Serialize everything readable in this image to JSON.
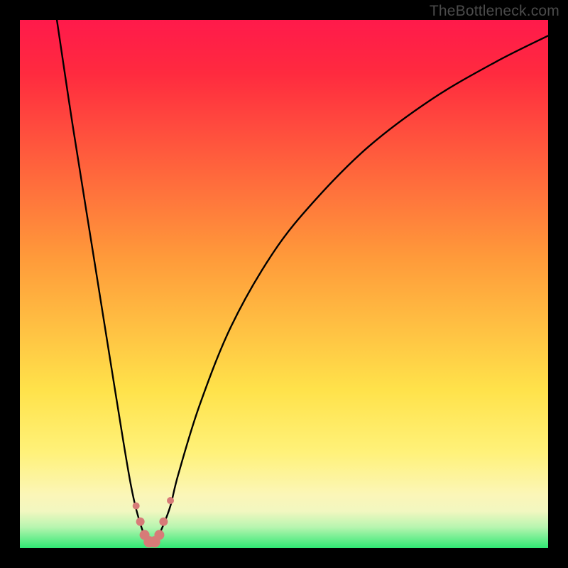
{
  "watermark": "TheBottleneck.com",
  "gradient": {
    "top": "#ff1a4b",
    "red": "#ff2a3f",
    "orange": "#ff9a3a",
    "yellow": "#ffe24a",
    "lightyellow": "#fff27a",
    "cream": "#fbf6b8",
    "paleyellow": "#f2f7c0",
    "palegreen": "#b8f5b0",
    "green": "#2fe873"
  },
  "chart_data": {
    "type": "line",
    "title": "",
    "xlabel": "",
    "ylabel": "",
    "xlim": [
      0,
      100
    ],
    "ylim": [
      0,
      100
    ],
    "note": "V-shaped bottleneck curve; y≈100 at edges, y≈0 near x≈25 (minimum). Axes unlabeled; values are pixel-proportion estimates.",
    "series": [
      {
        "name": "curve",
        "x": [
          7,
          10,
          14,
          18,
          21,
          23,
          24.5,
          25.5,
          27,
          28.5,
          30,
          34,
          40,
          48,
          56,
          66,
          78,
          90,
          100
        ],
        "y": [
          100,
          80,
          55,
          30,
          12,
          4,
          1,
          1,
          4,
          8,
          14,
          27,
          42,
          56,
          66,
          76,
          85,
          92,
          97
        ]
      }
    ],
    "markers": {
      "name": "highlighted-points",
      "color": "#d77b78",
      "points": [
        {
          "x": 22.0,
          "y": 8.0,
          "r": 5
        },
        {
          "x": 22.8,
          "y": 5.0,
          "r": 6
        },
        {
          "x": 23.6,
          "y": 2.5,
          "r": 7
        },
        {
          "x": 24.5,
          "y": 1.2,
          "r": 8
        },
        {
          "x": 25.5,
          "y": 1.2,
          "r": 8
        },
        {
          "x": 26.4,
          "y": 2.5,
          "r": 7
        },
        {
          "x": 27.2,
          "y": 5.0,
          "r": 6
        },
        {
          "x": 28.5,
          "y": 9.0,
          "r": 5
        }
      ]
    }
  }
}
